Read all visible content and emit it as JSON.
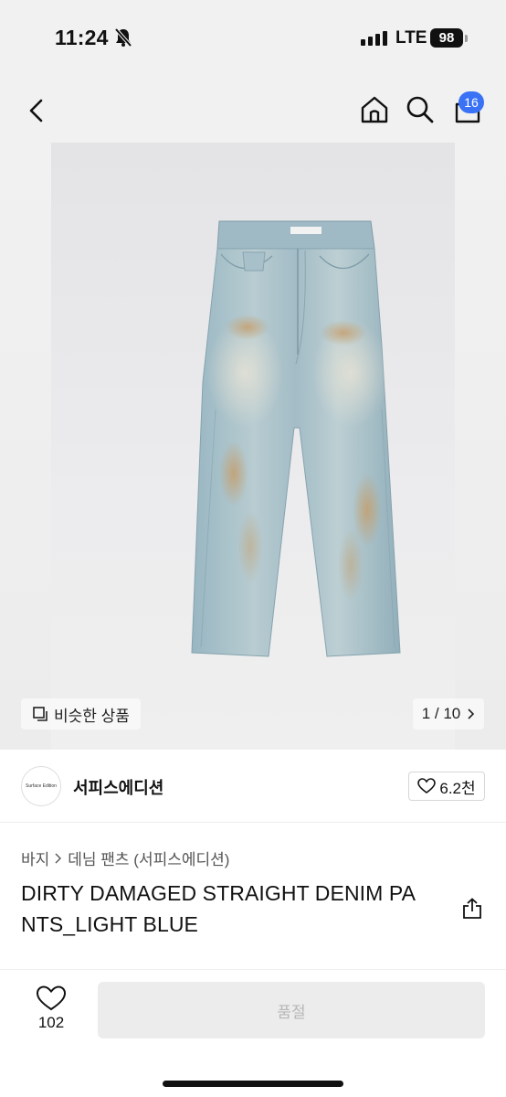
{
  "status_bar": {
    "time": "11:24",
    "network": "LTE",
    "battery": "98"
  },
  "nav": {
    "cart_count": "16"
  },
  "gallery": {
    "similar_label": "비슷한 상품",
    "pager": "1 / 10"
  },
  "shop": {
    "logo_text": "Surface Edition",
    "name": "서피스에디션",
    "likes": "6.2천"
  },
  "breadcrumb": {
    "level1": "바지",
    "level2": "데님 팬츠 (서피스에디션)"
  },
  "product": {
    "title": "DIRTY DAMAGED STRAIGHT DENIM PANTS_LIGHT BLUE",
    "title_line1": "DIRTY DAMAGED STRAIGHT DENIM PA",
    "title_line2": "NTS_LIGHT BLUE"
  },
  "bottom_bar": {
    "wish_count": "102",
    "soldout_label": "품절"
  },
  "colors": {
    "accent": "#3a72f6",
    "denim": "#a9c3cc"
  }
}
